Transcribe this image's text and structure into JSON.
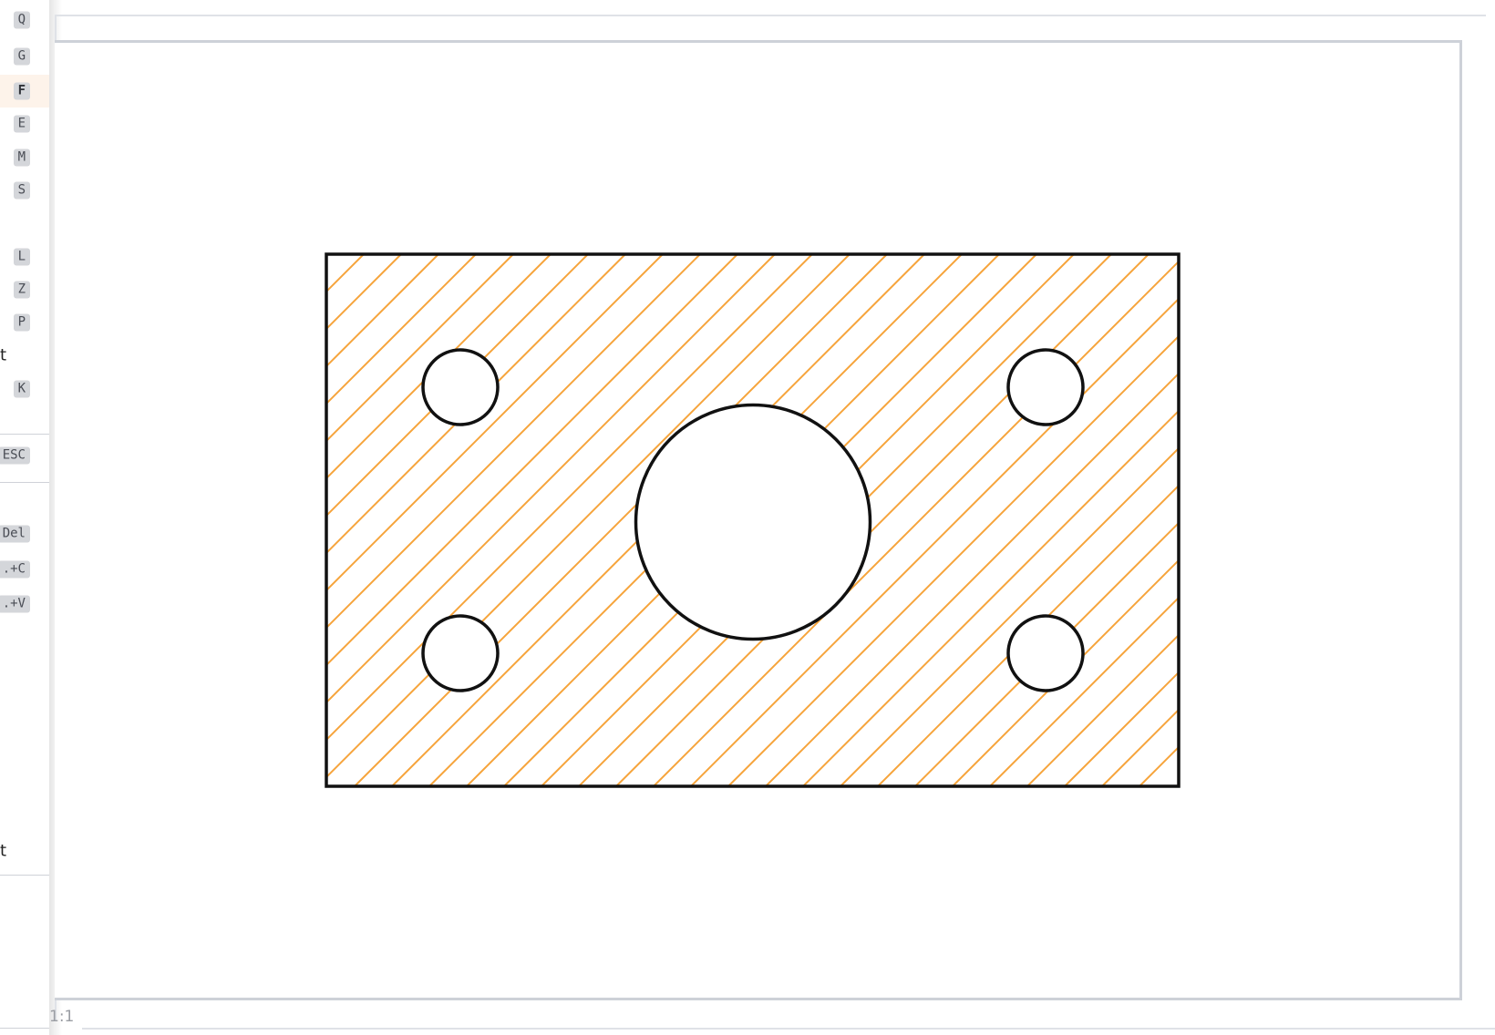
{
  "menu": {
    "shortcut_q": "Q",
    "shortcut_g": "G",
    "shortcut_f": "F",
    "shortcut_e": "E",
    "shortcut_m": "M",
    "shortcut_s": "S",
    "shortcut_l": "L",
    "shortcut_z": "Z",
    "shortcut_p": "P",
    "row_text_1": "t",
    "shortcut_k": "K",
    "shortcut_esc": "ESC",
    "shortcut_del": "Del",
    "shortcut_copy": ".+C",
    "shortcut_paste": ".+V",
    "row_text_2": "t"
  },
  "status": {
    "zoom": "1:1"
  },
  "drawing": {
    "stroke_color": "#111111",
    "hatch_color": "#f6a43b",
    "hatch": "diagonal",
    "shapes": [
      "rectangle",
      "center-hole",
      "corner-hole-top-left",
      "corner-hole-top-right",
      "corner-hole-bottom-left",
      "corner-hole-bottom-right"
    ]
  }
}
